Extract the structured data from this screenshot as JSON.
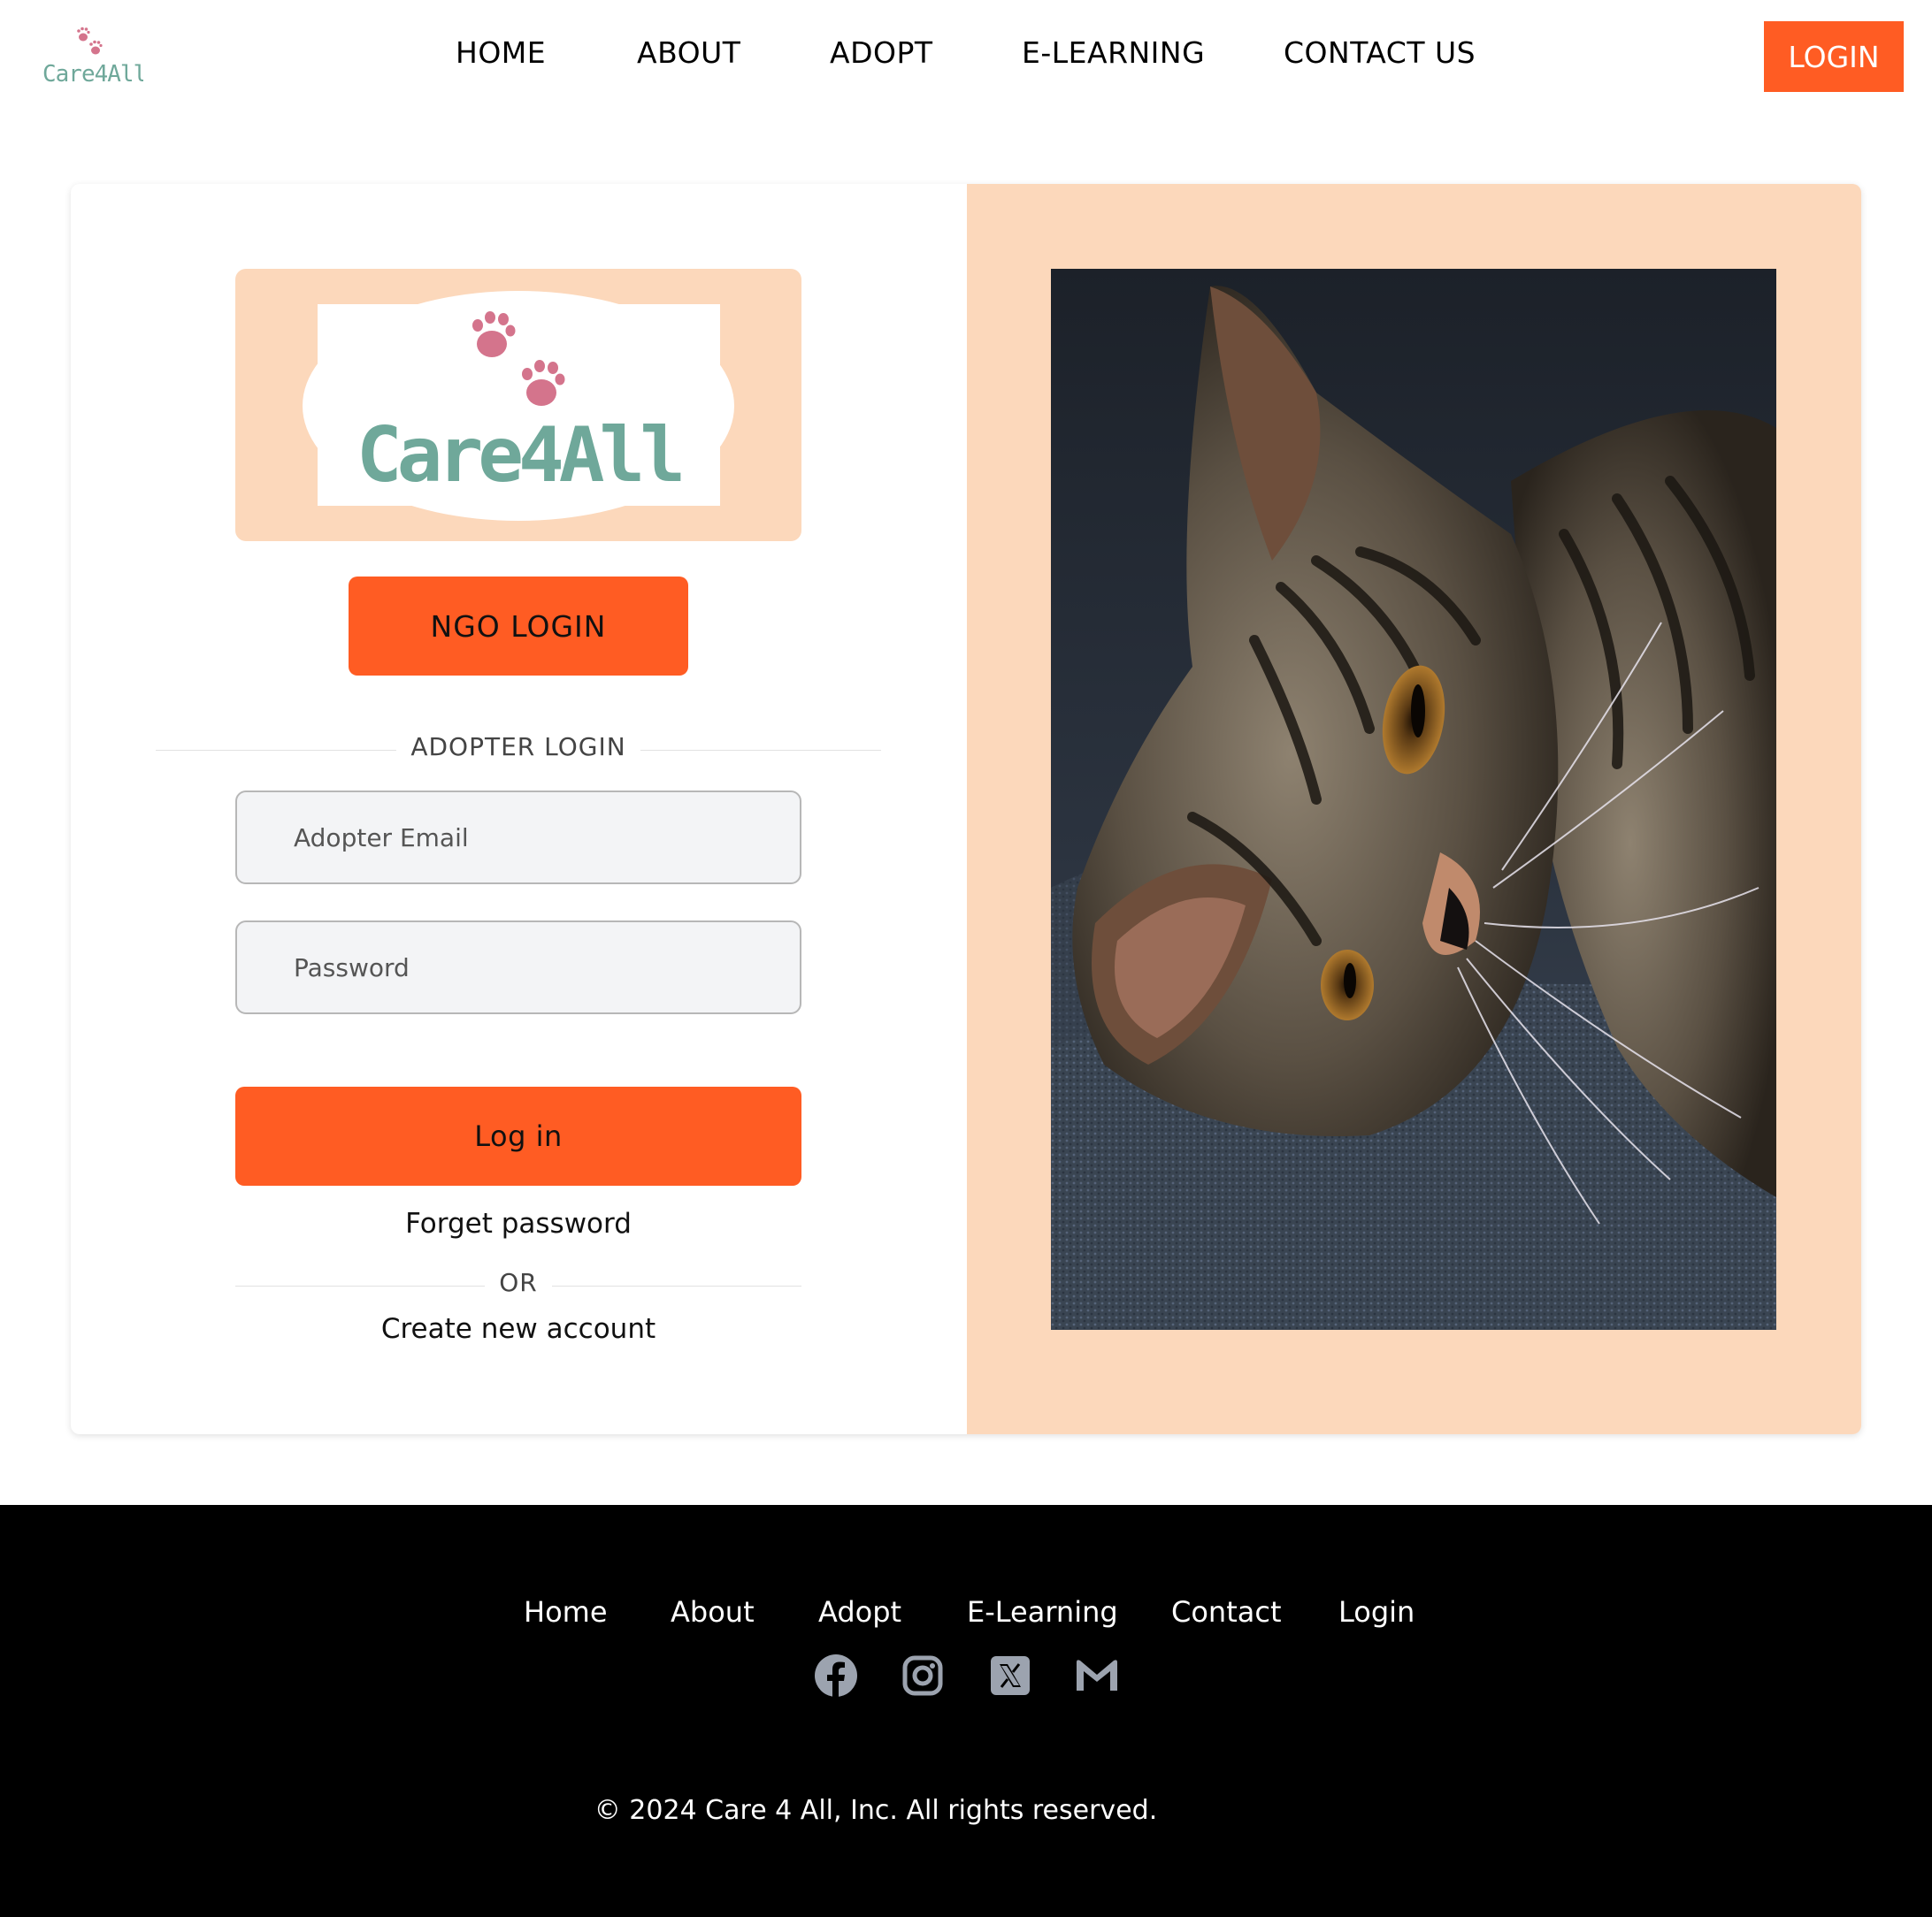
{
  "brand": {
    "name": "Care4All",
    "primary_color": "#ff5c23",
    "peach_color": "#fcd8bb",
    "logo_text_color": "#6fa89a",
    "paw_color": "#d4748c"
  },
  "nav": {
    "items": [
      {
        "label": "HOME"
      },
      {
        "label": "ABOUT"
      },
      {
        "label": "ADOPT"
      },
      {
        "label": "E-LEARNING"
      },
      {
        "label": "CONTACT US"
      }
    ],
    "login_label": "LOGIN"
  },
  "login_panel": {
    "ngo_login_label": "NGO LOGIN",
    "adopter_login_heading": "ADOPTER LOGIN",
    "email_placeholder": "Adopter Email",
    "password_placeholder": "Password",
    "submit_label": "Log in",
    "forgot_password": "Forget password",
    "or_text": "OR",
    "create_account": "Create new account"
  },
  "hero_image": {
    "subject": "tabby-kitten-photo"
  },
  "footer": {
    "links": [
      {
        "label": "Home"
      },
      {
        "label": "About"
      },
      {
        "label": "Adopt"
      },
      {
        "label": "E-Learning"
      },
      {
        "label": "Contact"
      },
      {
        "label": "Login"
      }
    ],
    "social_icons": [
      "facebook-icon",
      "instagram-icon",
      "x-icon",
      "gmail-icon"
    ],
    "copyright": "© 2024 Care 4 All, Inc. All rights reserved."
  }
}
